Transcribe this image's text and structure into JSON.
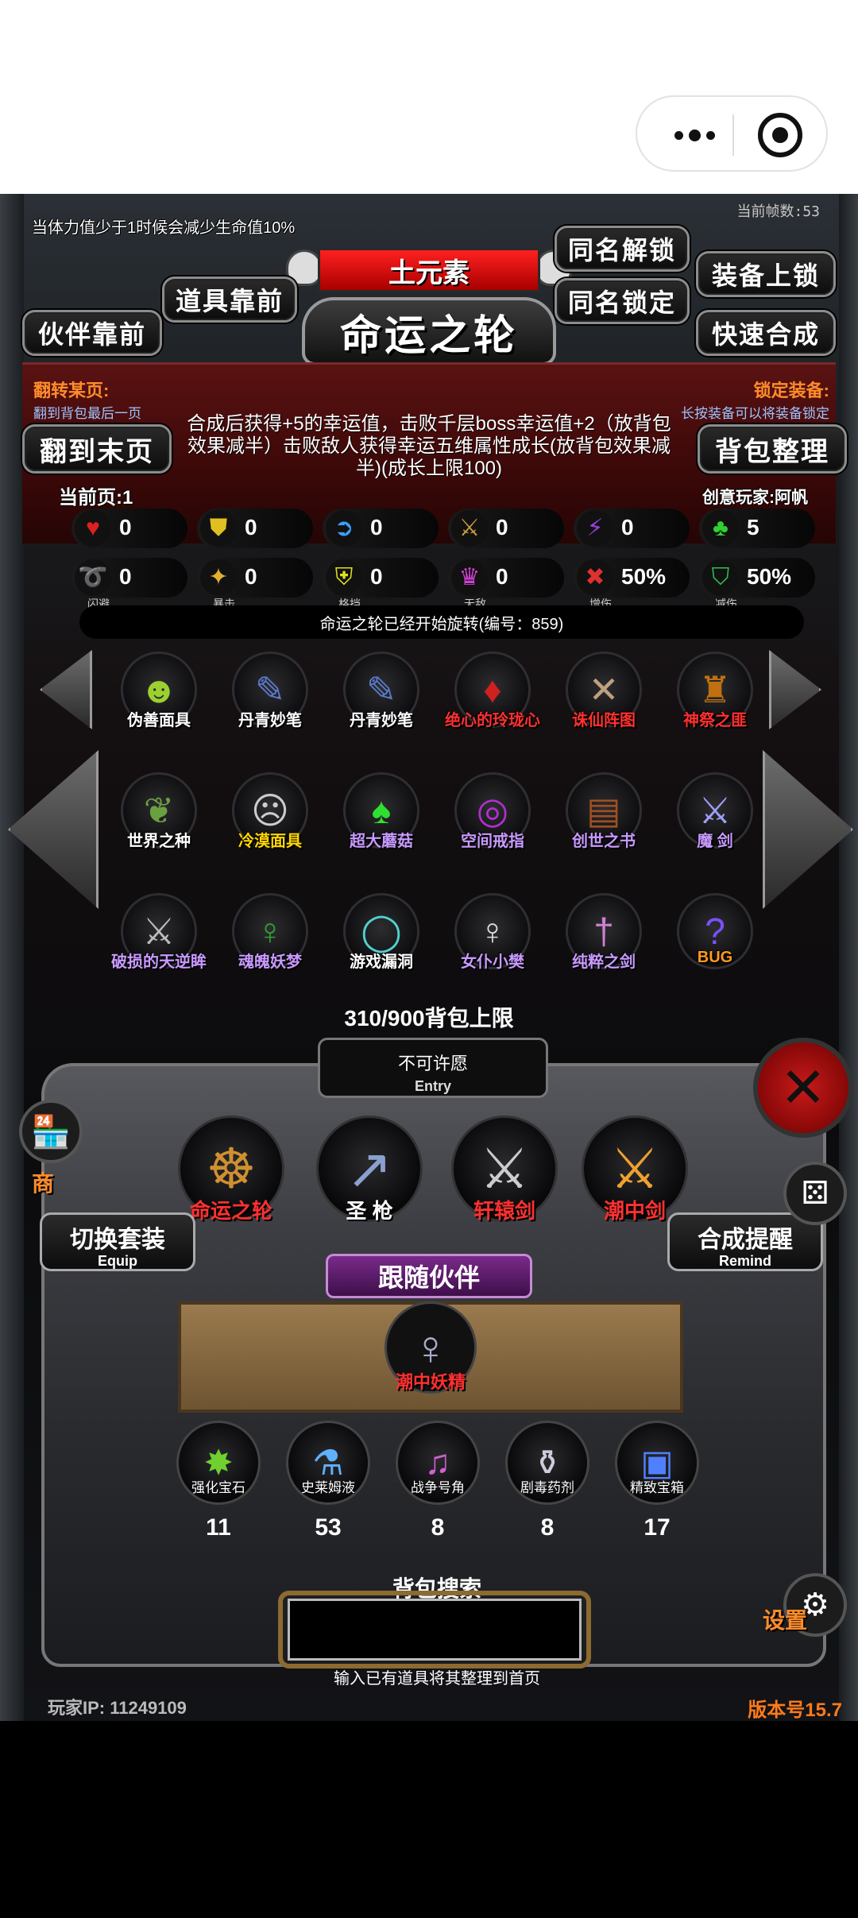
{
  "hud": {
    "warning": "当体力值少于1时候会减少生命值10%",
    "fps": "当前帧数:53"
  },
  "element_banner": "土元素",
  "title": "命运之轮",
  "buttons": {
    "same_unlock": "同名解锁",
    "same_lock": "同名锁定",
    "equip_lock": "装备上锁",
    "quick_merge": "快速合成",
    "item_front": "道具靠前",
    "partner_front": "伙伴靠前",
    "goto_last": "翻到末页",
    "sort_bag": "背包整理"
  },
  "info": {
    "flip_title": "翻转某页:",
    "flip_sub": "翻到背包最后一页",
    "lock_title": "锁定装备:",
    "lock_sub": "长按装备可以将装备锁定",
    "description": "合成后获得+5的幸运值，击败千层boss幸运值+2（放背包效果减半）击败敌人获得幸运五维属性成长(放背包效果减半)(成长上限100)",
    "current_page": "当前页:1",
    "creator": "创意玩家:阿帆"
  },
  "stats": [
    {
      "icon": "heart-icon",
      "glyph": "♥",
      "color": "#e02020",
      "value": "0",
      "label": ""
    },
    {
      "icon": "armor-icon",
      "glyph": "⛊",
      "color": "#e0c020",
      "value": "0",
      "label": ""
    },
    {
      "icon": "speed-boot-icon",
      "glyph": "➲",
      "color": "#3aa0ff",
      "value": "0",
      "label": ""
    },
    {
      "icon": "sword-icon",
      "glyph": "⚔",
      "color": "#d0a040",
      "value": "0",
      "label": ""
    },
    {
      "icon": "lightning-icon",
      "glyph": "⚡",
      "color": "#9a40e0",
      "value": "0",
      "label": ""
    },
    {
      "icon": "clover-icon",
      "glyph": "♣",
      "color": "#30d030",
      "value": "5",
      "label": ""
    },
    {
      "icon": "dodge-icon",
      "glyph": "➰",
      "color": "#3a90ff",
      "value": "0",
      "label": "闪避"
    },
    {
      "icon": "crit-icon",
      "glyph": "✦",
      "color": "#e0b030",
      "value": "0",
      "label": "暴击"
    },
    {
      "icon": "block-shield-icon",
      "glyph": "⛨",
      "color": "#e0e020",
      "value": "0",
      "label": "格挡"
    },
    {
      "icon": "invincible-wings-icon",
      "glyph": "♛",
      "color": "#d040d0",
      "value": "0",
      "label": "无敌"
    },
    {
      "icon": "damage-up-icon",
      "glyph": "✖",
      "color": "#e03030",
      "value": "50%",
      "label": "增伤"
    },
    {
      "icon": "damage-reduce-icon",
      "glyph": "⛉",
      "color": "#30c050",
      "value": "50%",
      "label": "减伤"
    }
  ],
  "spin_notice": "命运之轮已经开始旋转(编号：859)",
  "items": [
    {
      "name": "伪善面具",
      "glyph": "☻",
      "glyph_color": "#9bd030",
      "color": "#ffffff"
    },
    {
      "name": "丹青妙笔",
      "glyph": "✎",
      "glyph_color": "#5a7acc",
      "color": "#ffffff"
    },
    {
      "name": "丹青妙笔",
      "glyph": "✎",
      "glyph_color": "#5a7acc",
      "color": "#ffffff"
    },
    {
      "name": "绝心的玲珑心",
      "glyph": "♦",
      "glyph_color": "#d02020",
      "color": "#ff3030"
    },
    {
      "name": "诛仙阵图",
      "glyph": "✕",
      "glyph_color": "#c0a080",
      "color": "#ff3030"
    },
    {
      "name": "神祭之匪",
      "glyph": "♜",
      "glyph_color": "#c07010",
      "color": "#ff3030"
    },
    {
      "name": "世界之种",
      "glyph": "❦",
      "glyph_color": "#6aa040",
      "color": "#ffffff"
    },
    {
      "name": "冷漠面具",
      "glyph": "☹",
      "glyph_color": "#cccccc",
      "color": "#ffd700"
    },
    {
      "name": "超大蘑菇",
      "glyph": "♠",
      "glyph_color": "#30e030",
      "color": "#c89aff"
    },
    {
      "name": "空间戒指",
      "glyph": "◎",
      "glyph_color": "#b030d0",
      "color": "#c89aff"
    },
    {
      "name": "创世之书",
      "glyph": "▤",
      "glyph_color": "#a05020",
      "color": "#c89aff"
    },
    {
      "name": "魔 剑",
      "glyph": "⚔",
      "glyph_color": "#a0a0ff",
      "color": "#c89aff"
    },
    {
      "name": "破损的天逆眸",
      "glyph": "⚔",
      "glyph_color": "#bbbbbb",
      "color": "#c89aff"
    },
    {
      "name": "魂魄妖梦",
      "glyph": "♀",
      "glyph_color": "#30a030",
      "color": "#c89aff"
    },
    {
      "name": "游戏漏洞",
      "glyph": "◯",
      "glyph_color": "#50d0d0",
      "color": "#ffffff"
    },
    {
      "name": "女仆小樊",
      "glyph": "♀",
      "glyph_color": "#dddddd",
      "color": "#c89aff"
    },
    {
      "name": "纯粹之剑",
      "glyph": "†",
      "glyph_color": "#d080d0",
      "color": "#c89aff"
    },
    {
      "name": "BUG",
      "glyph": "?",
      "glyph_color": "#7a50ff",
      "color": "#ff9a20"
    }
  ],
  "capacity": "310/900背包上限",
  "entry": {
    "text": "不可许愿",
    "sub": "Entry"
  },
  "equipped": [
    {
      "name": "命运之轮",
      "glyph": "☸",
      "glyph_color": "#d09030",
      "white": false
    },
    {
      "name": "圣 枪",
      "glyph": "↗",
      "glyph_color": "#8aa0d0",
      "white": true
    },
    {
      "name": "轩辕剑",
      "glyph": "⚔",
      "glyph_color": "#cccccc",
      "white": false
    },
    {
      "name": "潮中剑",
      "glyph": "⚔",
      "glyph_color": "#f0a030",
      "white": false
    }
  ],
  "switch_equip": {
    "title": "切换套装",
    "sub": "Equip"
  },
  "merge_remind": {
    "title": "合成提醒",
    "sub": "Remind"
  },
  "follow_label": "跟随伙伴",
  "companion": {
    "name": "潮中妖精",
    "glyph": "♀"
  },
  "materials": [
    {
      "name": "强化宝石",
      "glyph": "✸",
      "glyph_color": "#70d030",
      "count": "11"
    },
    {
      "name": "史莱姆液",
      "glyph": "⚗",
      "glyph_color": "#60b0ff",
      "count": "53"
    },
    {
      "name": "战争号角",
      "glyph": "♫",
      "glyph_color": "#d060d0",
      "count": "8"
    },
    {
      "name": "剧毒药剂",
      "glyph": "⚱",
      "glyph_color": "#ccccdd",
      "count": "8"
    },
    {
      "name": "精致宝箱",
      "glyph": "▣",
      "glyph_color": "#5080ff",
      "count": "17"
    }
  ],
  "search": {
    "title": "背包搜索",
    "value": "",
    "hint": "输入已有道具将其整理到首页"
  },
  "footer": {
    "ip": "玩家IP:  11249109",
    "version": "版本号15.7"
  },
  "side": {
    "shop": "商",
    "settings": "设置"
  }
}
